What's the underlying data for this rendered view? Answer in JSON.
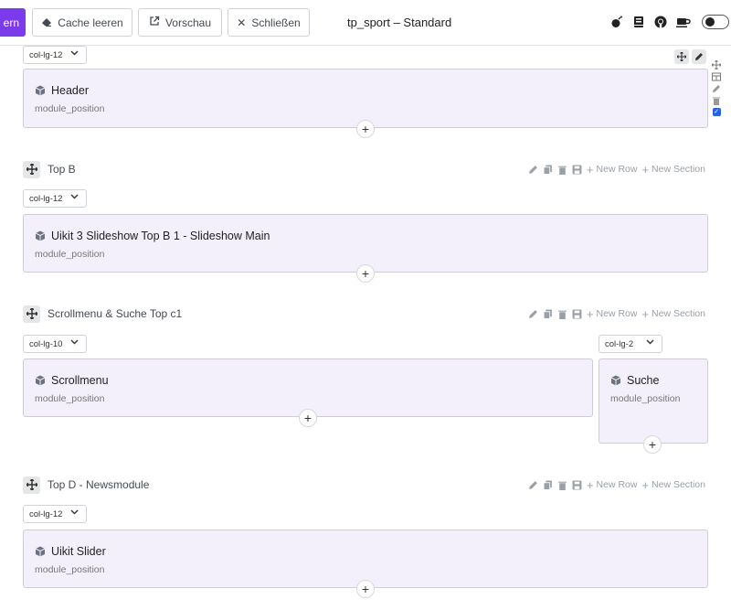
{
  "toolbar": {
    "save_label": "ern",
    "cache_label": "Cache leeren",
    "preview_label": "Vorschau",
    "close_label": "Schließen",
    "title": "tp_sport – Standard",
    "accent": "#7c3aed"
  },
  "rows": [
    {
      "columns": [
        {
          "col_class": "col-lg-12",
          "module_name": "Header",
          "position": "module_position"
        }
      ]
    },
    {
      "title": "Top B",
      "columns": [
        {
          "col_class": "col-lg-12",
          "module_name": "Uikit 3 Slideshow Top B 1 - Slideshow Main",
          "position": "module_position"
        }
      ]
    },
    {
      "title": "Scrollmenu & Suche Top c1",
      "columns": [
        {
          "col_class": "col-lg-10",
          "module_name": "Scrollmenu",
          "position": "module_position"
        },
        {
          "col_class": "col-lg-2",
          "module_name": "Suche",
          "position": "module_position"
        }
      ]
    },
    {
      "title": "Top D - Newsmodule",
      "columns": [
        {
          "col_class": "col-lg-12",
          "module_name": "Uikit Slider",
          "position": "module_position"
        }
      ]
    }
  ],
  "row_actions": {
    "new_row": "New Row",
    "new_section": "New Section"
  },
  "plus_symbol": "+"
}
